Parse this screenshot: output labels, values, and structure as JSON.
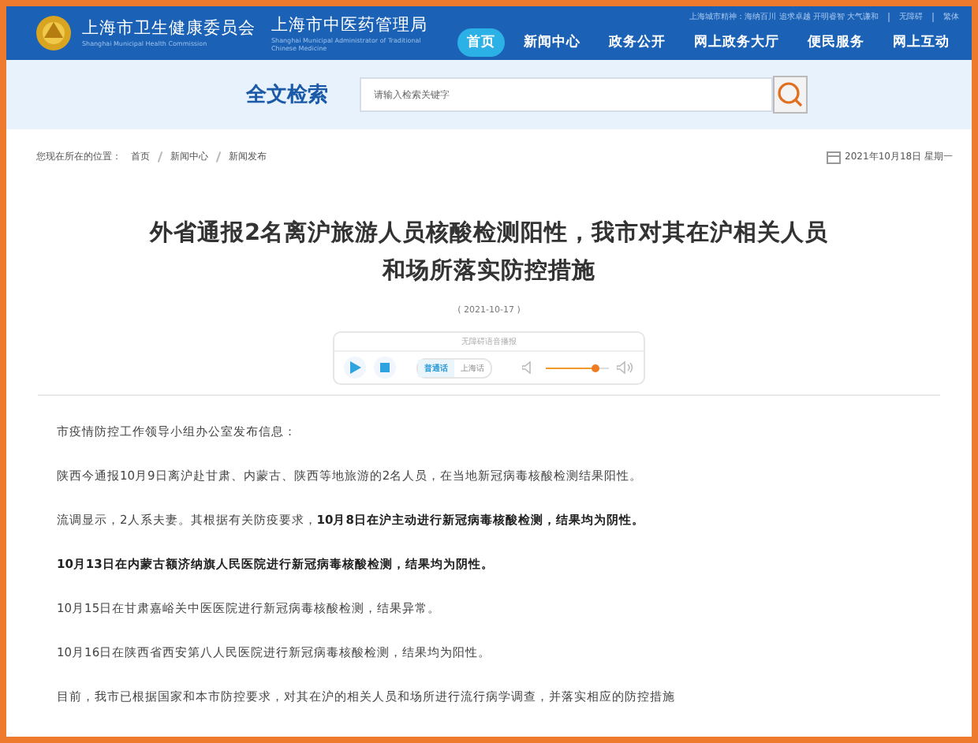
{
  "header": {
    "title_cn": "上海市卫生健康委员会",
    "title_en": "Shanghai Municipal Health Commission",
    "title2_cn": "上海市中医药管理局",
    "title2_en": "Shanghai Municipal Administrator of Traditional Chinese Medicine",
    "slogan": "上海城市精神：海纳百川 追求卓越 开明睿智 大气谦和",
    "links": [
      "无障碍",
      "繁体"
    ],
    "nav": [
      {
        "label": "首页",
        "selected": true
      },
      {
        "label": "新闻中心",
        "selected": false
      },
      {
        "label": "政务公开",
        "selected": false
      },
      {
        "label": "网上政务大厅",
        "selected": false
      },
      {
        "label": "便民服务",
        "selected": false
      },
      {
        "label": "网上互动",
        "selected": false
      }
    ]
  },
  "search": {
    "title": "全文检索",
    "placeholder": "请输入检索关键字"
  },
  "breadcrumb": {
    "label": "您现在所在的位置：",
    "items": [
      "首页",
      "新闻中心",
      "新闻发布"
    ],
    "date": "2021年10月18日 星期一"
  },
  "article": {
    "title_lines": [
      "外省通报2名离沪旅游人员核酸检测阳性，我市对其在沪相关人员",
      "和场所落实防控措施"
    ],
    "date": "( 2021-10-17 )",
    "player": {
      "label": "无障碍语音播报",
      "voices": [
        {
          "label": "普通话",
          "selected": true
        },
        {
          "label": "上海话",
          "selected": false
        }
      ]
    },
    "paragraphs": [
      "市疫情防控工作领导小组办公室发布信息：",
      "陕西今通报10月9日离沪赴甘肃、内蒙古、陕西等地旅游的2名人员，在当地新冠病毒核酸检测结果阳性。",
      "流调显示，2人系夫妻。其根据有关防疫要求，**10月8日在沪主动进行新冠病毒核酸检测，结果均为阴性。**",
      "**10月13日在内蒙古额济纳旗人民医院进行新冠病毒核酸检测，结果均为阴性。**",
      "10月15日在甘肃嘉峪关中医医院进行新冠病毒核酸检测，结果异常。",
      "10月16日在陕西省西安第八人民医院进行新冠病毒核酸检测，结果均为阳性。",
      "目前，我市已根据国家和本市防控要求，对其在沪的相关人员和场所进行流行病学调查，并落实相应的防控措施"
    ]
  }
}
